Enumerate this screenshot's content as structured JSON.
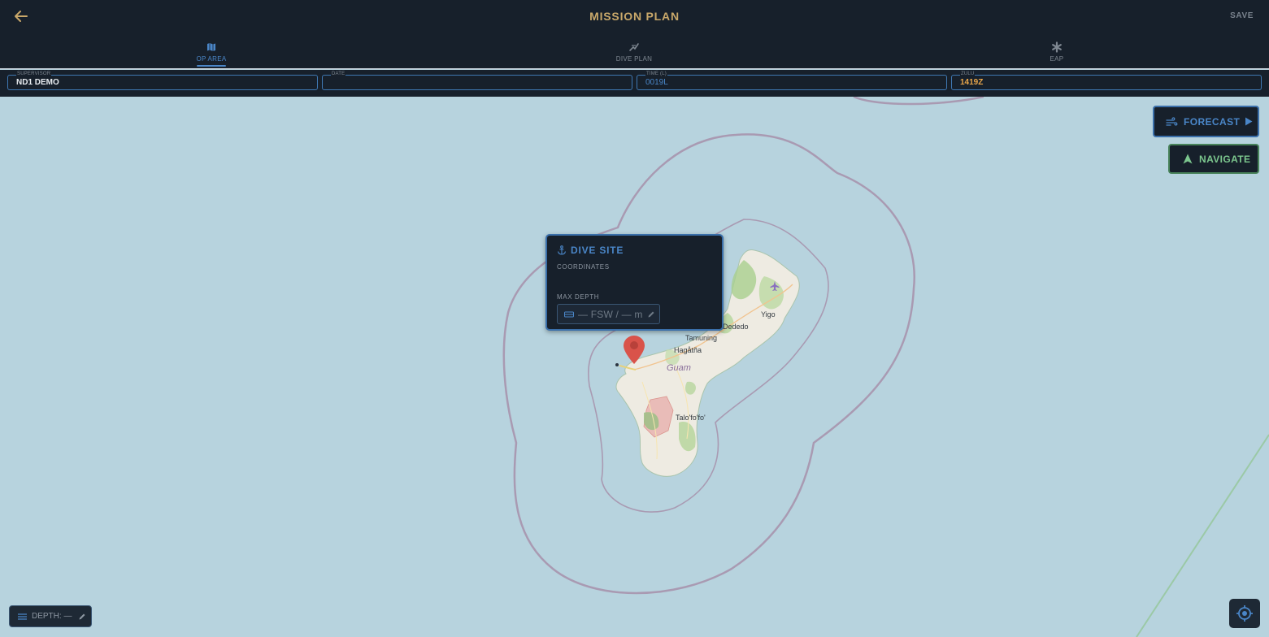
{
  "header": {
    "title": "MISSION PLAN",
    "save_label": "SAVE",
    "back_icon": "arrow-left-icon"
  },
  "tabs": [
    {
      "label": "OP AREA",
      "icon": "map-icon",
      "active": true
    },
    {
      "label": "DIVE PLAN",
      "icon": "dive-plan-icon",
      "active": false
    },
    {
      "label": "EAP",
      "icon": "asterisk-icon",
      "active": false
    }
  ],
  "fields": {
    "supervisor": {
      "label": "SUPERVISOR",
      "value": "ND1 DEMO"
    },
    "date": {
      "label": "DATE",
      "value": ""
    },
    "time_local": {
      "label": "TIME (L)",
      "value": "0019L"
    },
    "zulu": {
      "label": "ZULU",
      "value": "1419Z"
    }
  },
  "map": {
    "place_labels": [
      "Yigo",
      "Dededo",
      "Tamuning",
      "Hagåtña",
      "Guam",
      "Talo'fo'fo'"
    ],
    "airport_icon": "airplane-icon",
    "pin_icon": "map-pin-icon"
  },
  "popup": {
    "icon": "anchor-icon",
    "title": "DIVE SITE",
    "coordinates_label": "COORDINATES",
    "coordinates_value": "",
    "max_depth_label": "MAX DEPTH",
    "max_depth_value": "— FSW  /  — m",
    "ruler_icon": "ruler-icon",
    "edit_icon": "pencil-icon"
  },
  "buttons": {
    "forecast_label": "FORECAST",
    "forecast_icon": "wind-icon",
    "forecast_play_icon": "play-icon",
    "navigate_label": "NAVIGATE",
    "navigate_icon": "navigation-arrow-icon",
    "locate_icon": "crosshair-icon"
  },
  "depth_pill": {
    "label": "DEPTH: —",
    "icon": "menu-icon",
    "edit_icon": "pencil-icon"
  },
  "colors": {
    "header_bg": "#17202b",
    "title": "#c9a86a",
    "accent_blue": "#4a86c8",
    "accent_green": "#7cc78e",
    "zulu": "#e9a64a",
    "water": "#b7d3de",
    "pin": "#d9534a"
  }
}
